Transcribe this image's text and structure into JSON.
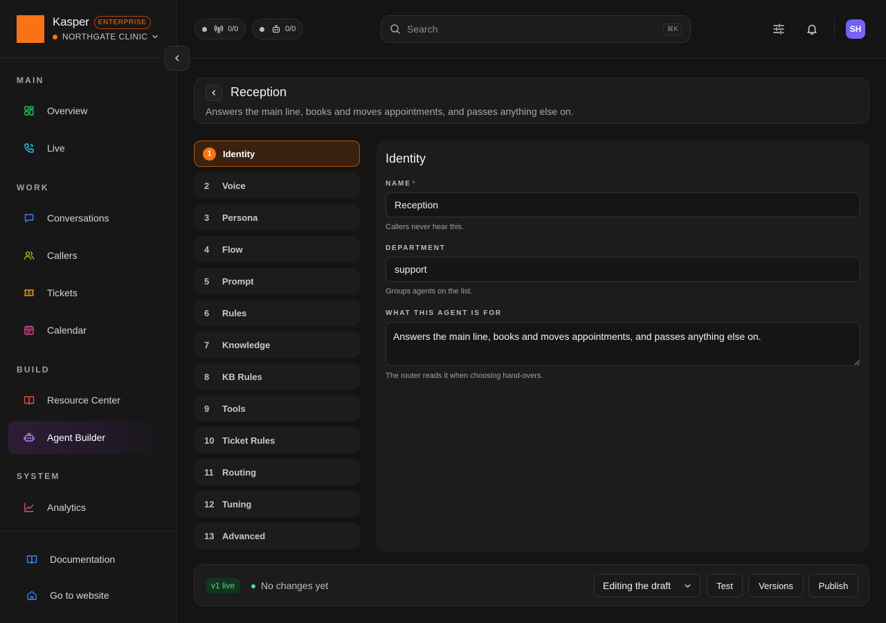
{
  "brand": {
    "name": "Kasper",
    "plan": "ENTERPRISE",
    "org": "NORTHGATE CLINIC"
  },
  "nav": {
    "sections": [
      "MAIN",
      "WORK",
      "BUILD",
      "SYSTEM"
    ],
    "items": [
      {
        "label": "Overview",
        "icon": "grid-icon"
      },
      {
        "label": "Live",
        "icon": "phone-icon"
      },
      {
        "label": "Conversations",
        "icon": "chat-icon"
      },
      {
        "label": "Callers",
        "icon": "users-icon"
      },
      {
        "label": "Tickets",
        "icon": "ticket-icon"
      },
      {
        "label": "Calendar",
        "icon": "calendar-icon"
      },
      {
        "label": "Resource Center",
        "icon": "book-icon"
      },
      {
        "label": "Agent Builder",
        "icon": "robot-icon",
        "active": true
      },
      {
        "label": "Analytics",
        "icon": "chart-icon"
      }
    ],
    "bottom": [
      {
        "label": "Documentation",
        "icon": "book-icon"
      },
      {
        "label": "Go to website",
        "icon": "home-icon"
      }
    ]
  },
  "topbar": {
    "live_calls": "0/0",
    "live_agents": "0/0",
    "search_placeholder": "Search",
    "search_shortcut": "⌘K",
    "avatar_initials": "SH"
  },
  "header": {
    "title": "Reception",
    "subtitle": "Answers the main line, books and moves appointments, and passes anything else on."
  },
  "steps": [
    {
      "num": "1",
      "label": "Identity",
      "active": true
    },
    {
      "num": "2",
      "label": "Voice"
    },
    {
      "num": "3",
      "label": "Persona"
    },
    {
      "num": "4",
      "label": "Flow"
    },
    {
      "num": "5",
      "label": "Prompt"
    },
    {
      "num": "6",
      "label": "Rules"
    },
    {
      "num": "7",
      "label": "Knowledge"
    },
    {
      "num": "8",
      "label": "KB Rules"
    },
    {
      "num": "9",
      "label": "Tools"
    },
    {
      "num": "10",
      "label": "Ticket Rules"
    },
    {
      "num": "11",
      "label": "Routing"
    },
    {
      "num": "12",
      "label": "Tuning"
    },
    {
      "num": "13",
      "label": "Advanced"
    }
  ],
  "form": {
    "title": "Identity",
    "name_label": "NAME",
    "name_required": "*",
    "name_value": "Reception",
    "name_hint": "Callers never hear this.",
    "dept_label": "DEPARTMENT",
    "dept_value": "support",
    "dept_hint": "Groups agents on the list.",
    "purpose_label": "WHAT THIS AGENT IS FOR",
    "purpose_value": "Answers the main line, books and moves appointments, and passes anything else on.",
    "purpose_hint": "The router reads it when choosing hand-overs."
  },
  "footer": {
    "version_badge": "v1 live",
    "status": "No changes yet",
    "mode": "Editing the draft",
    "test_label": "Test",
    "versions_label": "Versions",
    "publish_label": "Publish"
  },
  "colors": {
    "accent": "#f97316",
    "active_nav": "#2c1d35",
    "live_green": "#4ade80"
  }
}
